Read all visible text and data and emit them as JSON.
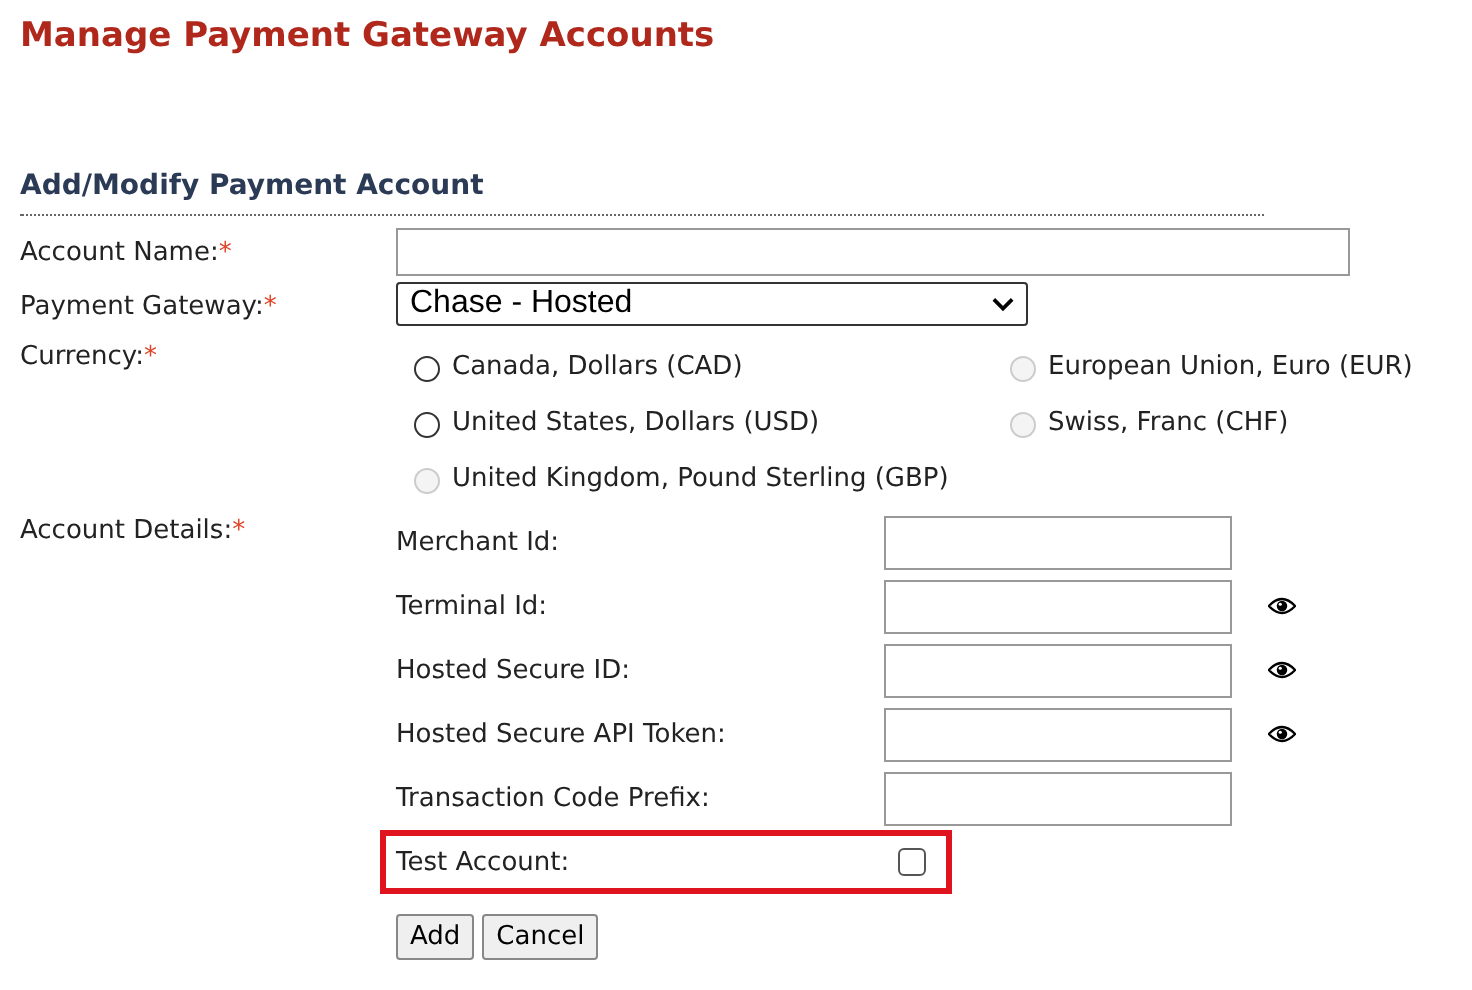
{
  "title": "Manage Payment Gateway Accounts",
  "section": "Add/Modify Payment Account",
  "account_name": {
    "label": "Account Name:",
    "required_mark": "*"
  },
  "gateway": {
    "label": "Payment Gateway:",
    "required_mark": "*",
    "value": "Chase - Hosted"
  },
  "currency": {
    "label": "Currency:",
    "required_mark": "*",
    "options": [
      {
        "label": "Canada, Dollars (CAD)",
        "selected": false,
        "disabled": false
      },
      {
        "label": "European Union, Euro (EUR)",
        "selected": false,
        "disabled": true
      },
      {
        "label": "United States, Dollars (USD)",
        "selected": false,
        "disabled": false
      },
      {
        "label": "Swiss, Franc (CHF)",
        "selected": false,
        "disabled": true
      },
      {
        "label": "United Kingdom, Pound Sterling (GBP)",
        "selected": false,
        "disabled": true
      }
    ]
  },
  "details": {
    "label": "Account Details:",
    "required_mark": "*",
    "fields": [
      {
        "kind": "text",
        "label": "Merchant Id:",
        "reveal": false,
        "highlighted": false
      },
      {
        "kind": "text",
        "label": "Terminal Id:",
        "reveal": true,
        "highlighted": false
      },
      {
        "kind": "text",
        "label": "Hosted Secure ID:",
        "reveal": true,
        "highlighted": false
      },
      {
        "kind": "text",
        "label": "Hosted Secure API Token:",
        "reveal": true,
        "highlighted": false
      },
      {
        "kind": "text",
        "label": "Transaction Code Prefix:",
        "reveal": false,
        "highlighted": false
      },
      {
        "kind": "checkbox",
        "label": "Test Account:",
        "checked": false,
        "highlighted": true
      }
    ]
  },
  "buttons": [
    "Add",
    "Cancel"
  ]
}
